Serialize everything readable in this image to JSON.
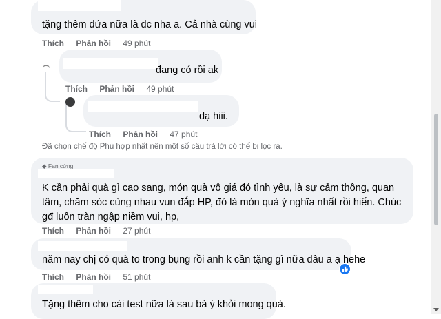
{
  "comments": [
    {
      "text": "tặng thêm đứa nữa là đc nha a. Cả nhà cùng vui",
      "like": "Thích",
      "reply": "Phản hồi",
      "time": "49 phút"
    },
    {
      "text": "đang có rồi ak",
      "like": "Thích",
      "reply": "Phản hồi",
      "time": "49 phút"
    },
    {
      "text": "dạ hiii.",
      "like": "Thích",
      "reply": "Phản hồi",
      "time": "47 phút"
    },
    {
      "badge": "Fan cứng",
      "text": "K cần phải quà gì cao sang, món quà vô giá đó tình yêu, là sự cảm thông, quan tâm, chăm sóc cùng nhau vun đắp HP, đó là món quà ý nghĩa nhất rồi hiển. Chúc gđ luôn tràn ngập niềm vui, hp,",
      "like": "Thích",
      "reply": "Phản hồi",
      "time": "27 phút"
    },
    {
      "text": "năm nay chị có quà to trong bụng rồi anh k cần tặng gì nữa đâu a ạ hehe",
      "like": "Thích",
      "reply": "Phản hồi",
      "time": "51 phút"
    },
    {
      "text": "Tặng thêm cho cái test nữa là sau bà ý khỏi mong quà."
    }
  ],
  "filter_note": "Đã chọn chế độ Phù hợp nhất nên một số câu trả lời có thể bị lọc ra.",
  "colors": {
    "bubble": "#f0f2f5",
    "meta": "#65676b",
    "like_badge": "#1877f2"
  }
}
